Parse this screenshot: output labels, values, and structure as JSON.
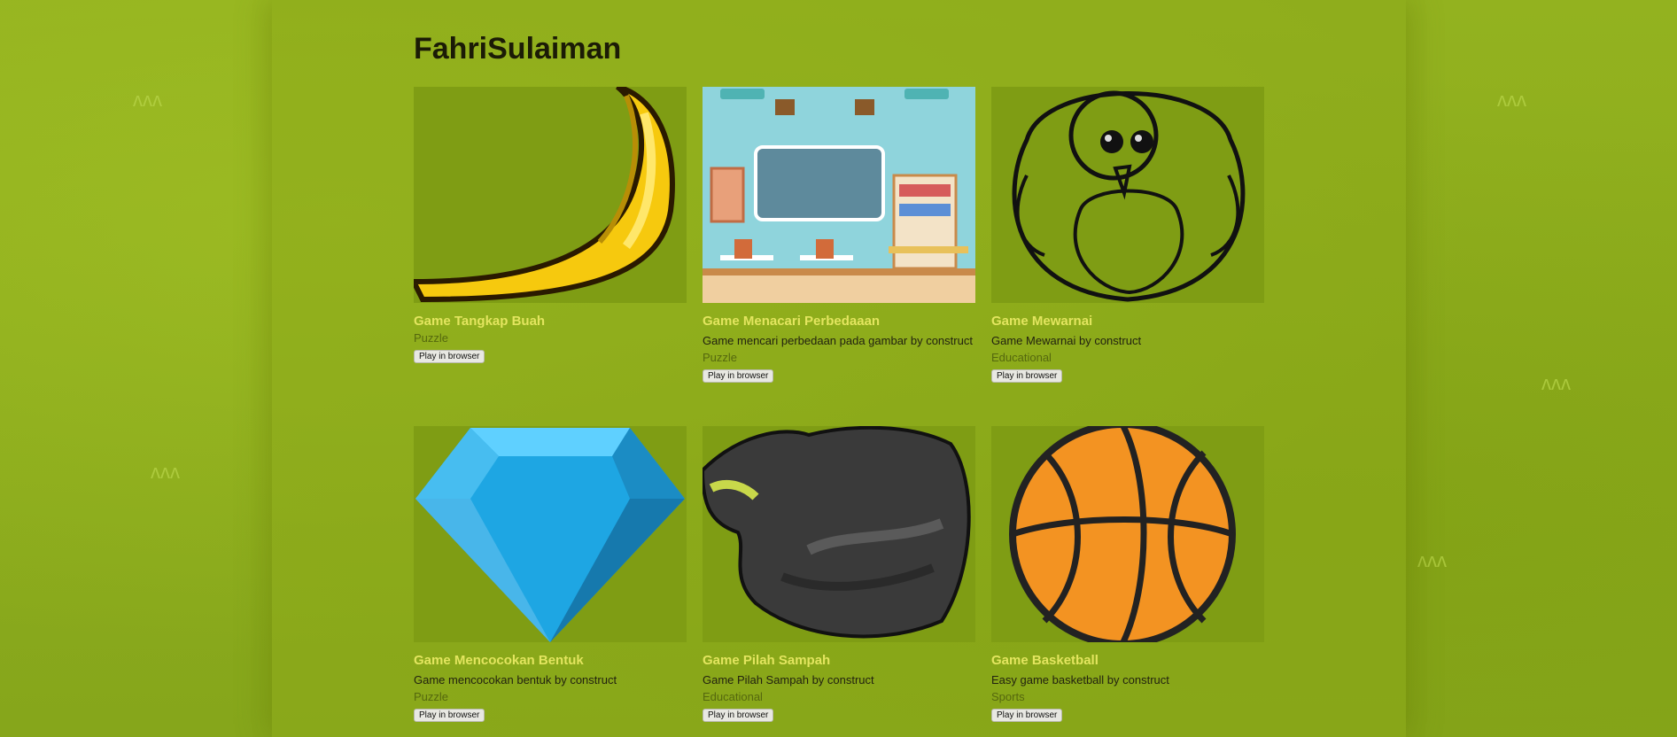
{
  "page": {
    "user": "FahriSulaiman"
  },
  "games": [
    {
      "title": "Game Tangkap Buah",
      "description": "",
      "genre": "Puzzle",
      "play_label": "Play in browser",
      "thumb_icon": "banana-icon"
    },
    {
      "title": "Game Menacari Perbedaaan",
      "description": "Game mencari perbedaan pada gambar by construct",
      "genre": "Puzzle",
      "play_label": "Play in browser",
      "thumb_icon": "classroom-image"
    },
    {
      "title": "Game Mewarnai",
      "description": "Game Mewarnai by construct",
      "genre": "Educational",
      "play_label": "Play in browser",
      "thumb_icon": "owl-outline-icon"
    },
    {
      "title": "Game Mencocokan Bentuk",
      "description": "Game mencocokan bentuk by construct",
      "genre": "Puzzle",
      "play_label": "Play in browser",
      "thumb_icon": "diamond-icon"
    },
    {
      "title": "Game Pilah Sampah",
      "description": "Game Pilah Sampah by construct",
      "genre": "Educational",
      "play_label": "Play in browser",
      "thumb_icon": "trash-bag-icon"
    },
    {
      "title": "Game Basketball",
      "description": "Easy game basketball by construct",
      "genre": "Sports",
      "play_label": "Play in browser",
      "thumb_icon": "basketball-icon"
    }
  ],
  "colors": {
    "background": "#8aaa1c",
    "title_link": "#e3e55f",
    "genre_text": "#55680e"
  }
}
